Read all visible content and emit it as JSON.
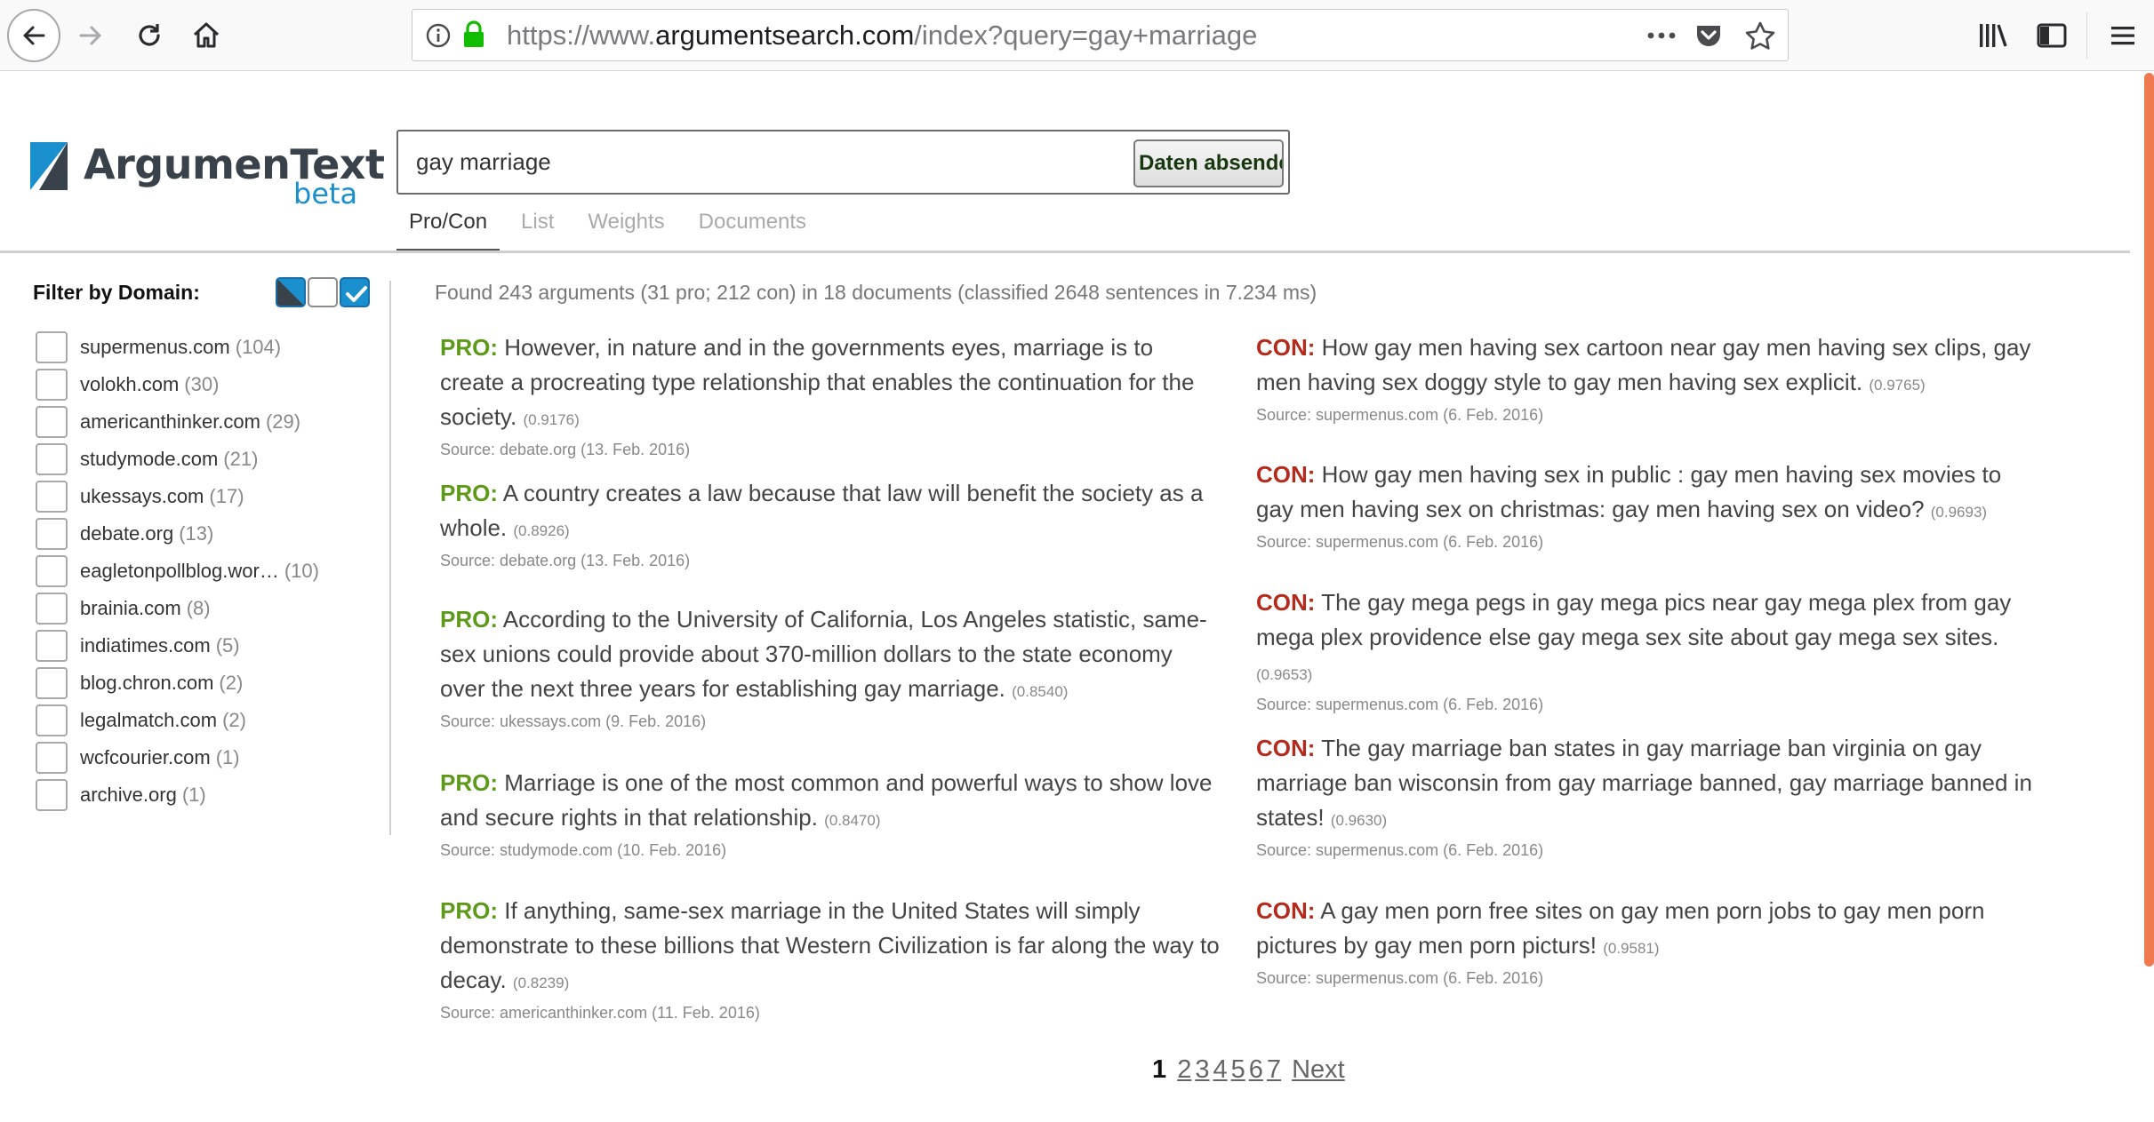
{
  "browser": {
    "url_prefix": "https://www.",
    "url_host": "argumentsearch.com",
    "url_path": "/index?query=gay+marriage"
  },
  "logo": {
    "name": "ArgumenText",
    "tag": "beta"
  },
  "search": {
    "value": "gay marriage",
    "submit_label": "Daten absenden"
  },
  "tabs": [
    {
      "label": "Pro/Con",
      "active": true
    },
    {
      "label": "List",
      "active": false
    },
    {
      "label": "Weights",
      "active": false
    },
    {
      "label": "Documents",
      "active": false
    }
  ],
  "filter": {
    "title": "Filter by Domain:",
    "domains": [
      {
        "name": "supermenus.com",
        "count": "(104)"
      },
      {
        "name": "volokh.com",
        "count": "(30)"
      },
      {
        "name": "americanthinker.com",
        "count": "(29)"
      },
      {
        "name": "studymode.com",
        "count": "(21)"
      },
      {
        "name": "ukessays.com",
        "count": "(17)"
      },
      {
        "name": "debate.org",
        "count": "(13)"
      },
      {
        "name": "eagletonpollblog.wor…",
        "count": "(10)"
      },
      {
        "name": "brainia.com",
        "count": "(8)"
      },
      {
        "name": "indiatimes.com",
        "count": "(5)"
      },
      {
        "name": "blog.chron.com",
        "count": "(2)"
      },
      {
        "name": "legalmatch.com",
        "count": "(2)"
      },
      {
        "name": "wcfcourier.com",
        "count": "(1)"
      },
      {
        "name": "archive.org",
        "count": "(1)"
      }
    ]
  },
  "results": {
    "summary": "Found 243 arguments (31 pro; 212 con) in 18 documents (classified 2648 sentences in 7.234 ms)",
    "pro": [
      {
        "label": "PRO:",
        "text": "However, in nature and in the governments eyes, marriage is to create a procreating type relationship that enables the continuation for the society.",
        "score": "(0.9176)",
        "source": "Source: debate.org (13. Feb. 2016)"
      },
      {
        "label": "PRO:",
        "text": "A country creates a law because that law will benefit the society as a whole.",
        "score": "(0.8926)",
        "source": "Source: debate.org (13. Feb. 2016)"
      },
      {
        "label": "PRO:",
        "text": "According to the University of California, Los Angeles statistic, same-sex unions could provide about 370-million dollars to the state economy over the next three years for establishing gay marriage.",
        "score": "(0.8540)",
        "source": "Source: ukessays.com (9. Feb. 2016)"
      },
      {
        "label": "PRO:",
        "text": "Marriage is one of the most common and powerful ways to show love and secure rights in that relationship.",
        "score": "(0.8470)",
        "source": "Source: studymode.com (10. Feb. 2016)"
      },
      {
        "label": "PRO:",
        "text": "If anything, same-sex marriage in the United States will simply demonstrate to these billions that Western Civilization is far along the way to decay.",
        "score": "(0.8239)",
        "source": "Source: americanthinker.com (11. Feb. 2016)"
      }
    ],
    "con": [
      {
        "label": "CON:",
        "text": "How gay men having sex cartoon near gay men having sex clips, gay men having sex doggy style to gay men having sex explicit.",
        "score": "(0.9765)",
        "source": "Source: supermenus.com (6. Feb. 2016)"
      },
      {
        "label": "CON:",
        "text": "How gay men having sex in public : gay men having sex movies to gay men having sex on christmas: gay men having sex on video?",
        "score": "(0.9693)",
        "source": "Source: supermenus.com (6. Feb. 2016)"
      },
      {
        "label": "CON:",
        "text": "The gay mega pegs in gay mega pics near gay mega plex from gay mega plex providence else gay mega sex site about gay mega sex sites.",
        "score": "(0.9653)",
        "source": "Source: supermenus.com (6. Feb. 2016)"
      },
      {
        "label": "CON:",
        "text": "The gay marriage ban states in gay marriage ban virginia on gay marriage ban wisconsin from gay marriage banned, gay marriage banned in states!",
        "score": "(0.9630)",
        "source": "Source: supermenus.com (6. Feb. 2016)"
      },
      {
        "label": "CON:",
        "text": "A gay men porn free sites on gay men porn jobs to gay men porn pictures by gay men porn picturs!",
        "score": "(0.9581)",
        "source": "Source: supermenus.com (6. Feb. 2016)"
      }
    ]
  },
  "pagination": {
    "current": "1",
    "pages": [
      "2",
      "3",
      "4",
      "5",
      "6",
      "7"
    ],
    "next": "Next"
  },
  "colors": {
    "pro": "#5e9a1a",
    "con": "#b52a1a",
    "brand": "#1a8fcd"
  }
}
